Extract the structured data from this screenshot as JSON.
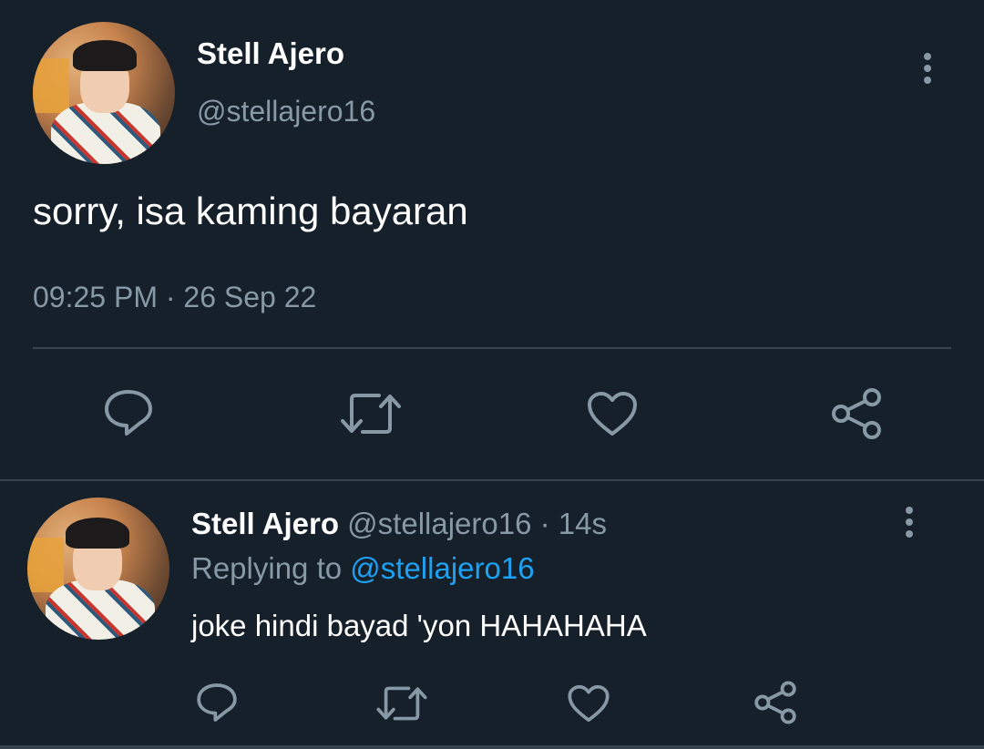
{
  "main_tweet": {
    "display_name": "Stell Ajero",
    "handle": "@stellajero16",
    "text": "sorry, isa kaming bayaran",
    "time": "09:25 PM",
    "separator": "·",
    "date": "26 Sep 22",
    "avatar_icon": "avatar-photo",
    "more_icon": "more-vertical-icon",
    "actions": [
      {
        "name": "reply",
        "icon": "reply-icon"
      },
      {
        "name": "retweet",
        "icon": "retweet-icon"
      },
      {
        "name": "like",
        "icon": "heart-icon"
      },
      {
        "name": "share",
        "icon": "share-icon"
      }
    ]
  },
  "reply_tweet": {
    "display_name": "Stell Ajero",
    "handle": "@stellajero16",
    "separator": "·",
    "relative_time": "14s",
    "replying_to_label": "Replying to",
    "replying_to_handle": "@stellajero16",
    "text": "joke hindi bayad 'yon HAHAHAHA",
    "avatar_icon": "avatar-photo",
    "more_icon": "more-vertical-icon",
    "actions": [
      {
        "name": "reply",
        "icon": "reply-icon"
      },
      {
        "name": "retweet",
        "icon": "retweet-icon"
      },
      {
        "name": "like",
        "icon": "heart-icon"
      },
      {
        "name": "share",
        "icon": "share-icon"
      }
    ]
  },
  "colors": {
    "background": "#15202b",
    "primary_text": "#ffffff",
    "secondary_text": "#8899a6",
    "accent": "#1da1f2",
    "divider": "#38444d"
  }
}
